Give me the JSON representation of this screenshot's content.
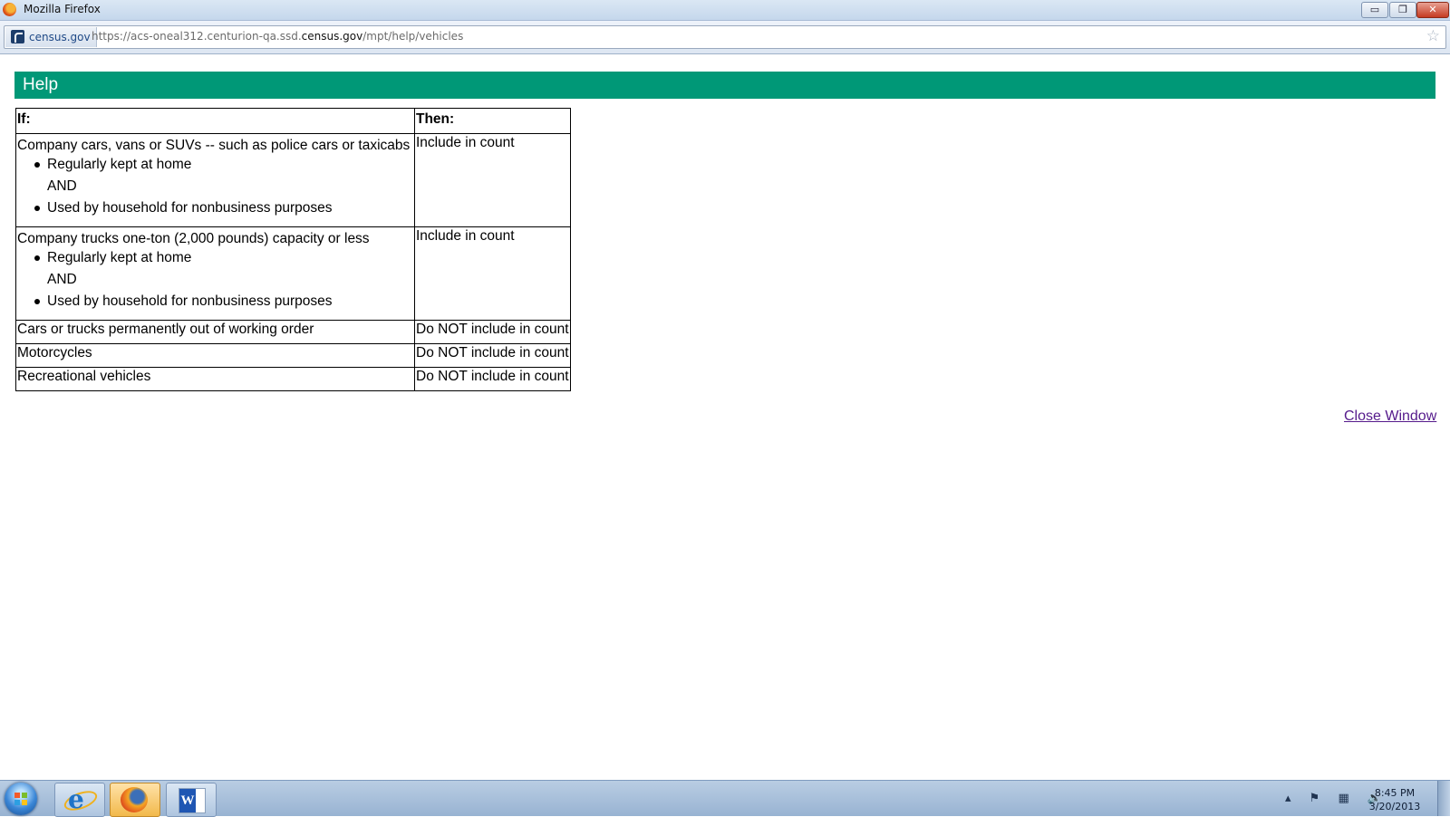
{
  "window": {
    "title": "Mozilla Firefox",
    "minimize_glyph": "▭",
    "restore_glyph": "❐",
    "close_glyph": "✕"
  },
  "address_bar": {
    "site_identity": "census.gov",
    "url_prefix": "https://acs-oneal312.centurion-qa.ssd.",
    "url_domain": "census.gov",
    "url_path": "/mpt/help/vehicles",
    "bookmark_glyph": "☆"
  },
  "page": {
    "header": "Help",
    "table": {
      "headers": {
        "if": "If:",
        "then": "Then:"
      },
      "rows": [
        {
          "condition": "Company cars, vans or SUVs -- such as police cars or taxicabs",
          "bullet1": "Regularly kept at home",
          "connector": "AND",
          "bullet2": "Used by household for nonbusiness purposes",
          "result": "Include in count"
        },
        {
          "condition": "Company trucks one-ton (2,000 pounds) capacity or less",
          "bullet1": "Regularly kept at home",
          "connector": "AND",
          "bullet2": "Used by household for nonbusiness purposes",
          "result": "Include in count"
        },
        {
          "condition": "Cars or trucks permanently out of working order",
          "result": "Do NOT include in count"
        },
        {
          "condition": "Motorcycles",
          "result": "Do NOT include in count"
        },
        {
          "condition": "Recreational vehicles",
          "result": "Do NOT include in count"
        }
      ]
    },
    "close_link": "Close Window"
  },
  "taskbar": {
    "apps": [
      "internet-explorer",
      "firefox",
      "word"
    ],
    "word_letter": "W",
    "ie_letter": "e",
    "tray_icons": "▴ ⚑ ▦ 🔊",
    "clock_time": "8:45 PM",
    "clock_date": "3/20/2013"
  },
  "colors": {
    "header_bg": "#009877",
    "header_text": "#ffffff",
    "link_visited": "#551a8b"
  }
}
